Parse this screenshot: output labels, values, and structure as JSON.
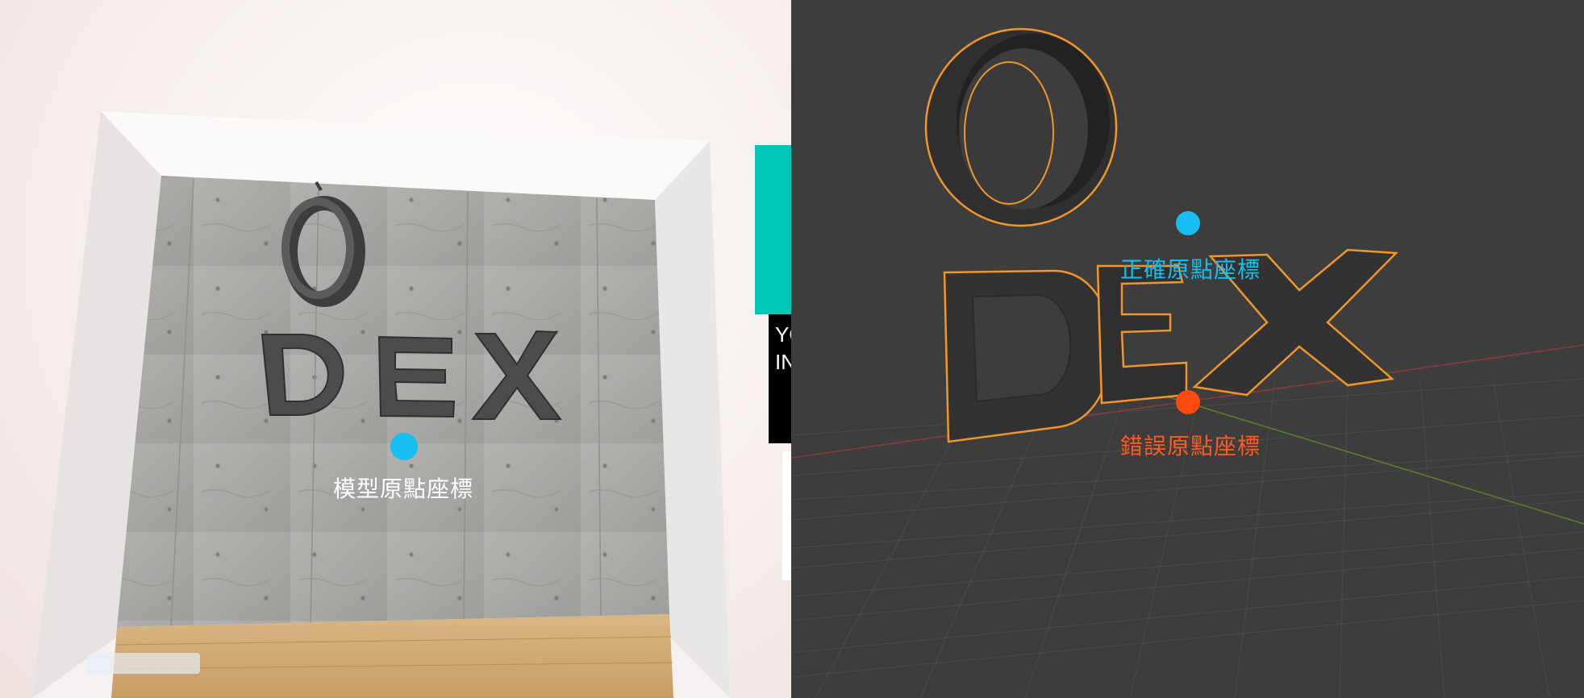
{
  "left_view": {
    "origin_label": "模型原點座標",
    "panel_text": "YO\nIN",
    "logo_text": {
      "o": "O",
      "dex": "DEX"
    },
    "colors": {
      "origin_dot": "#17bef0",
      "teal_panel": "#00c7b7",
      "wall": "#a9aaa7",
      "floor": "#c9a572"
    }
  },
  "right_view": {
    "correct_origin_label": "正確原點座標",
    "wrong_origin_label": "錯誤原點座標",
    "logo_text": {
      "o": "O",
      "dex": "DEX"
    },
    "colors": {
      "correct_dot": "#17bef0",
      "wrong_dot": "#ff4a0f",
      "selection_outline": "#f0962a",
      "background": "#3d3d3d"
    }
  }
}
